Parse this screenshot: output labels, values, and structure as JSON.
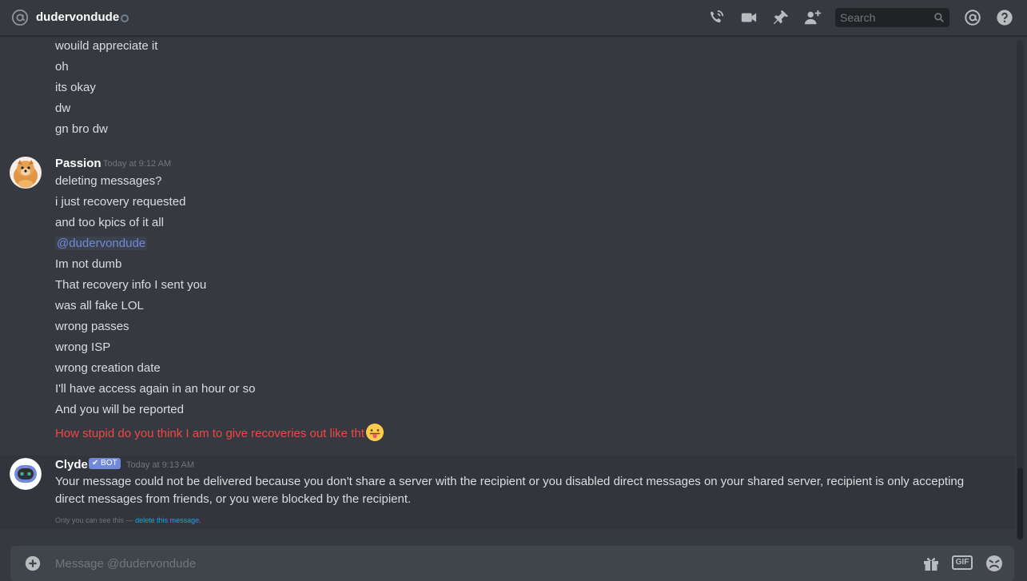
{
  "header": {
    "channel_name": "dudervondude",
    "search_placeholder": "Search"
  },
  "messages": {
    "continued_lines": [
      "wouild appreciate it",
      "oh",
      "its okay",
      "dw",
      "gn bro dw"
    ],
    "passion": {
      "username": "Passion",
      "timestamp": "Today at 9:12 AM",
      "lines": [
        "deleting messages?",
        "i just recovery requested",
        "and too kpics of it all",
        "@dudervondude",
        "Im not dumb",
        "That recovery info I sent you",
        "was all fake LOL",
        "wrong passes",
        "wrong ISP",
        "wrong creation date",
        "I'll have access again in an hour or so",
        "And you will be reported",
        "How stupid do you think I am to give recoveries out like tht"
      ]
    },
    "clyde": {
      "username": "Clyde",
      "badge": "BOT",
      "timestamp": "Today at 9:13 AM",
      "text": "Your message could not be delivered because you don't share a server with the recipient or you disabled direct messages on your shared server, recipient is only accepting direct messages from friends, or you were blocked by the recipient.",
      "ephemeral_note": "Only you can see this —",
      "delete_link": "delete this message."
    }
  },
  "composer": {
    "placeholder": "Message @dudervondude",
    "gif_label": "GIF"
  },
  "colors": {
    "background": "#36393f",
    "mention": "#7289da",
    "alert_red": "#f04747",
    "link": "#00b0f4"
  }
}
